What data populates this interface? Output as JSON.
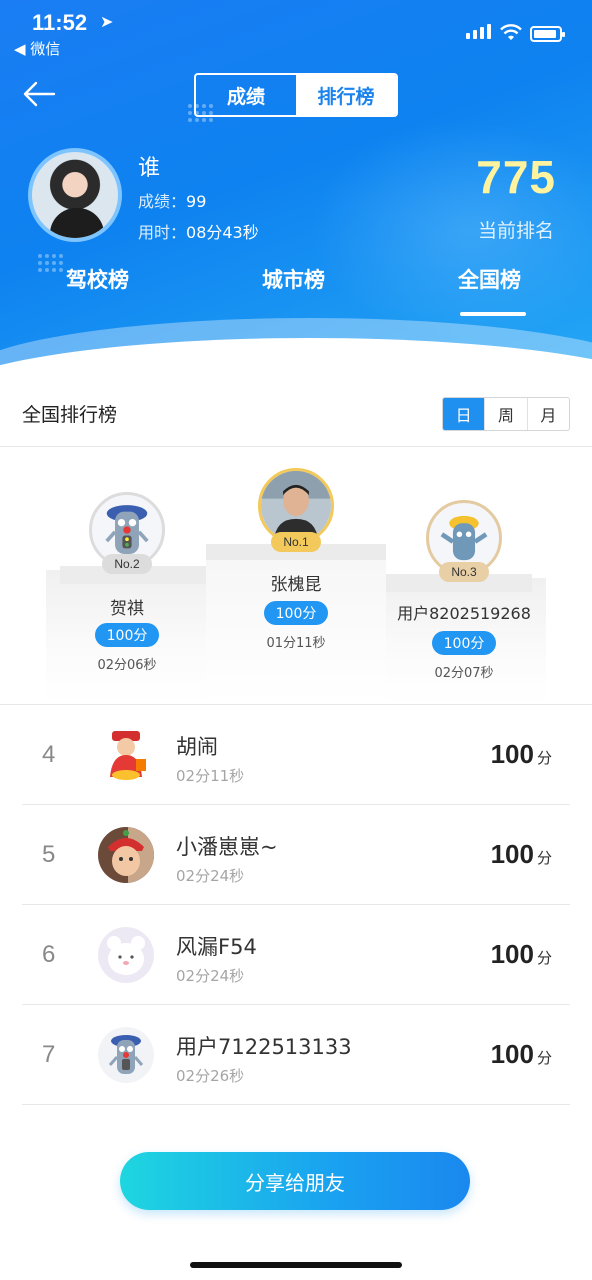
{
  "status_bar": {
    "time": "11:52",
    "back_app": "◀ 微信"
  },
  "segment": {
    "left": "成绩",
    "right": "排行榜"
  },
  "me": {
    "name": "谁",
    "score_label": "成绩：",
    "score": "99",
    "time_label": "用时：",
    "time": "08分43秒",
    "rank": "775",
    "rank_label": "当前排名"
  },
  "tabs": [
    "驾校榜",
    "城市榜",
    "全国榜"
  ],
  "board": {
    "title": "全国排行榜",
    "periods": [
      "日",
      "周",
      "月"
    ]
  },
  "podium": {
    "first": {
      "badge": "No.1",
      "name": "张槐昆",
      "score": "100分",
      "time": "01分11秒"
    },
    "second": {
      "badge": "No.2",
      "name": "贺祺",
      "score": "100分",
      "time": "02分06秒"
    },
    "third": {
      "badge": "No.3",
      "name": "用户8202519268",
      "score": "100分",
      "time": "02分07秒"
    }
  },
  "list": [
    {
      "rank": "4",
      "name": "胡闹",
      "time": "02分11秒",
      "score": "100",
      "unit": "分",
      "avatar_icon": "god-of-wealth-avatar"
    },
    {
      "rank": "5",
      "name": "小潘崽崽~",
      "time": "02分24秒",
      "score": "100",
      "unit": "分",
      "avatar_icon": "child-photo-avatar"
    },
    {
      "rank": "6",
      "name": "风漏F54",
      "time": "02分24秒",
      "score": "100",
      "unit": "分",
      "avatar_icon": "white-bear-avatar"
    },
    {
      "rank": "7",
      "name": "用户7122513133",
      "time": "02分26秒",
      "score": "100",
      "unit": "分",
      "avatar_icon": "traffic-light-mascot-avatar"
    }
  ],
  "share_button": "分享给朋友",
  "colors": {
    "header_blue": "#1a7df3",
    "rank_yellow": "#fff3a0",
    "score_pill": "#2196f3",
    "gold": "#f2c95a"
  }
}
